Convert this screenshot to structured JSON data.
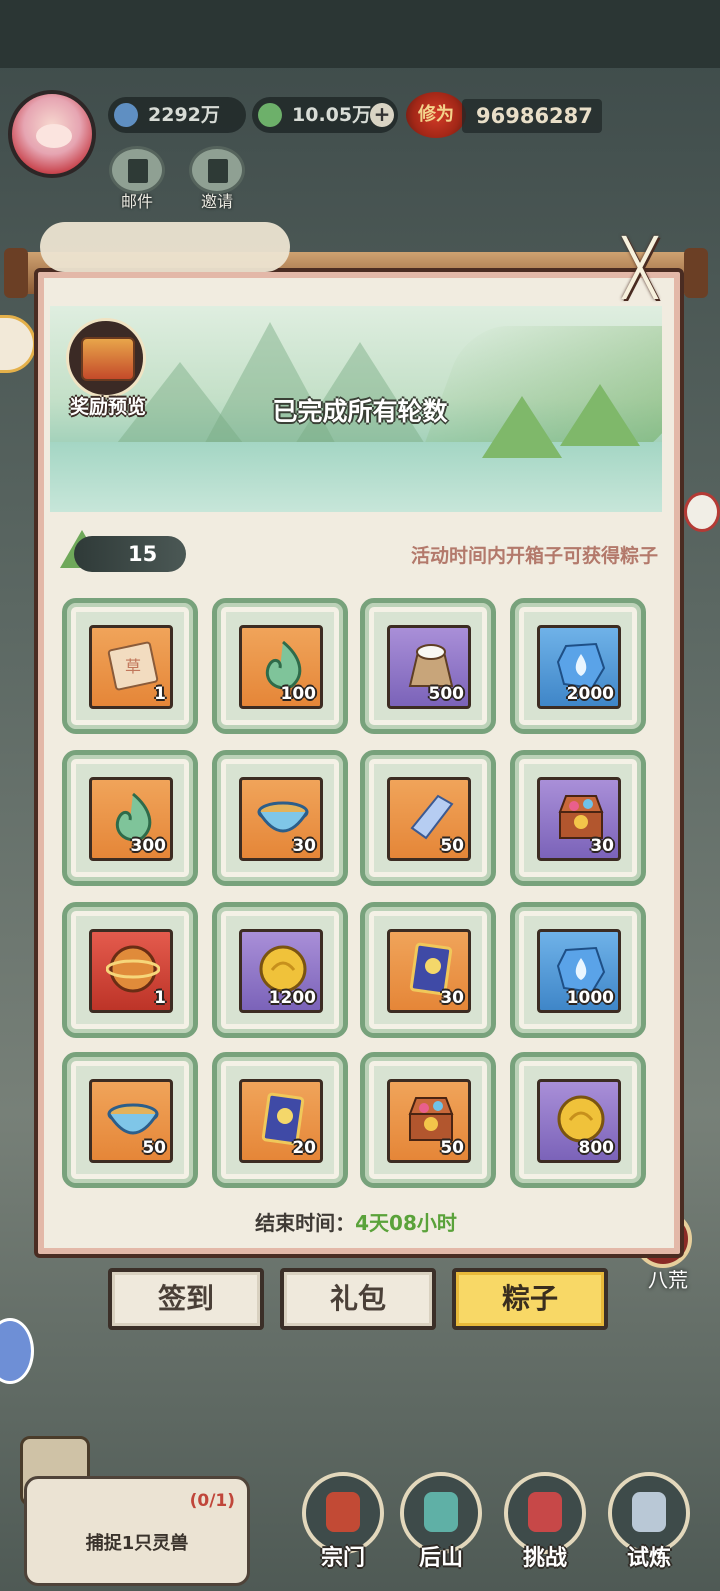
{
  "header": {
    "spirit_stones": "2292万",
    "jade": "10.05万",
    "plus_symbol": "+",
    "power_badge": "修为",
    "power_value": "96986287",
    "mail_label": "邮件",
    "invite_label": "邀请"
  },
  "panel": {
    "close_symbol": "╳",
    "reward_preview_label": "奖励预览",
    "status_text": "已完成所有轮数",
    "zongzi_count": "15",
    "activity_hint": "活动时间内开箱子可获得粽子",
    "end_time_label": "结束时间：",
    "end_time_value": "4天08小时",
    "rewards": [
      {
        "qty": "1",
        "icon": "scroll-icon",
        "bg": "orange"
      },
      {
        "qty": "100",
        "icon": "jade-swirl-icon",
        "bg": "orange"
      },
      {
        "qty": "500",
        "icon": "rice-sack-icon",
        "bg": "purple"
      },
      {
        "qty": "2000",
        "icon": "spirit-stone-icon",
        "bg": "blue"
      },
      {
        "qty": "300",
        "icon": "jade-swirl-icon",
        "bg": "orange"
      },
      {
        "qty": "30",
        "icon": "soup-bowl-icon",
        "bg": "orange"
      },
      {
        "qty": "50",
        "icon": "crystal-bar-icon",
        "bg": "orange"
      },
      {
        "qty": "30",
        "icon": "treasure-chest-icon",
        "bg": "purple"
      },
      {
        "qty": "1",
        "icon": "orb-icon",
        "bg": "red"
      },
      {
        "qty": "1200",
        "icon": "gold-coin-icon",
        "bg": "purple"
      },
      {
        "qty": "30",
        "icon": "talisman-card-icon",
        "bg": "orange"
      },
      {
        "qty": "1000",
        "icon": "spirit-stone-icon",
        "bg": "blue"
      },
      {
        "qty": "50",
        "icon": "soup-bowl-icon",
        "bg": "orange"
      },
      {
        "qty": "20",
        "icon": "talisman-card-icon",
        "bg": "orange"
      },
      {
        "qty": "50",
        "icon": "treasure-chest-icon",
        "bg": "orange"
      },
      {
        "qty": "800",
        "icon": "gold-coin-icon",
        "bg": "purple"
      }
    ]
  },
  "tabs": [
    "签到",
    "礼包",
    "粽子"
  ],
  "active_tab": "粽子",
  "right_side": {
    "bahuang_label": "八荒"
  },
  "quest": {
    "progress": "(0/1)",
    "text": "捕捉1只灵兽"
  },
  "bottom_nav": [
    "宗门",
    "后山",
    "挑战",
    "试炼"
  ],
  "colors": {
    "tab_active": "#f8d866",
    "slot_border": "#78a27c",
    "end_time_value": "#5aa23a",
    "hint_text": "#b3796b"
  }
}
